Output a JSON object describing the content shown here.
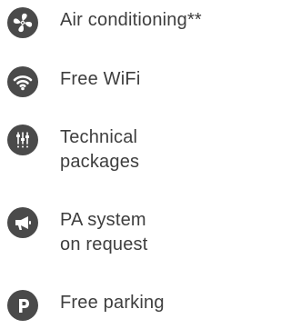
{
  "amenities": [
    {
      "icon": "fan-icon",
      "lines": [
        "Air conditioning**"
      ]
    },
    {
      "icon": "wifi-icon",
      "lines": [
        "Free WiFi"
      ]
    },
    {
      "icon": "mixer-sliders-icon",
      "lines": [
        "Technical",
        "packages"
      ]
    },
    {
      "icon": "megaphone-icon",
      "lines": [
        "PA system",
        "on request"
      ]
    },
    {
      "icon": "parking-icon",
      "lines": [
        "Free parking"
      ]
    }
  ],
  "colors": {
    "icon_bg": "#4a4a4a",
    "icon_fg": "#ffffff",
    "text": "#3e3e3e"
  }
}
